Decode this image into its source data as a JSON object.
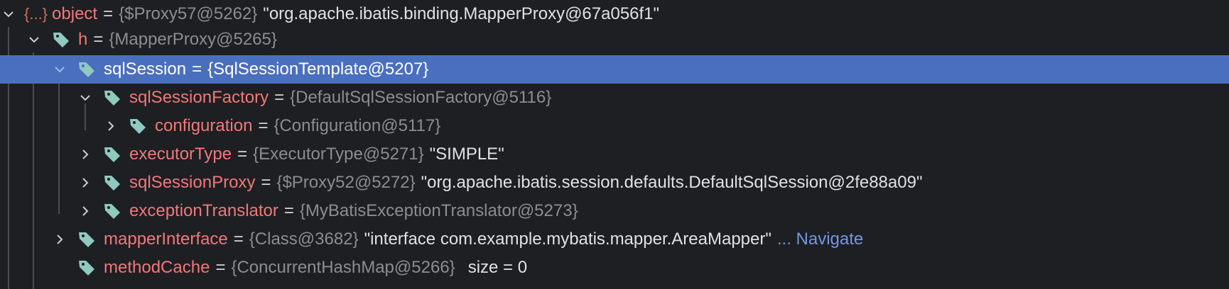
{
  "colors": {
    "background": "#1e1f22",
    "selection": "#4a6fbe",
    "field_name": "#f0787b",
    "type_text": "#8a8d94",
    "value_text": "#dfe1e5",
    "link": "#6f98e6",
    "tag_icon": "#8fc9bf",
    "object_icon": "#c9735a"
  },
  "tree": {
    "object": {
      "icon": "{...}",
      "name": "object",
      "eq": "=",
      "type": "{$Proxy57@5262}",
      "value": "\"org.apache.ibatis.binding.MapperProxy@67a056f1\""
    },
    "h": {
      "name": "h",
      "eq": "=",
      "type": "{MapperProxy@5265}"
    },
    "sqlSession": {
      "name": "sqlSession",
      "eq": "=",
      "type": "{SqlSessionTemplate@5207}"
    },
    "sqlSessionFactory": {
      "name": "sqlSessionFactory",
      "eq": "=",
      "type": "{DefaultSqlSessionFactory@5116}"
    },
    "configuration": {
      "name": "configuration",
      "eq": "=",
      "type": "{Configuration@5117}"
    },
    "executorType": {
      "name": "executorType",
      "eq": "=",
      "type": "{ExecutorType@5271}",
      "value": "\"SIMPLE\""
    },
    "sqlSessionProxy": {
      "name": "sqlSessionProxy",
      "eq": "=",
      "type": "{$Proxy52@5272}",
      "value": "\"org.apache.ibatis.session.defaults.DefaultSqlSession@2fe88a09\""
    },
    "exceptionTranslator": {
      "name": "exceptionTranslator",
      "eq": "=",
      "type": "{MyBatisExceptionTranslator@5273}"
    },
    "mapperInterface": {
      "name": "mapperInterface",
      "eq": "=",
      "type": "{Class@3682}",
      "value": "\"interface com.example.mybatis.mapper.AreaMapper\"",
      "link": "... Navigate"
    },
    "methodCache": {
      "name": "methodCache",
      "eq": "=",
      "type": "{ConcurrentHashMap@5266}",
      "extra": "size = 0"
    }
  }
}
